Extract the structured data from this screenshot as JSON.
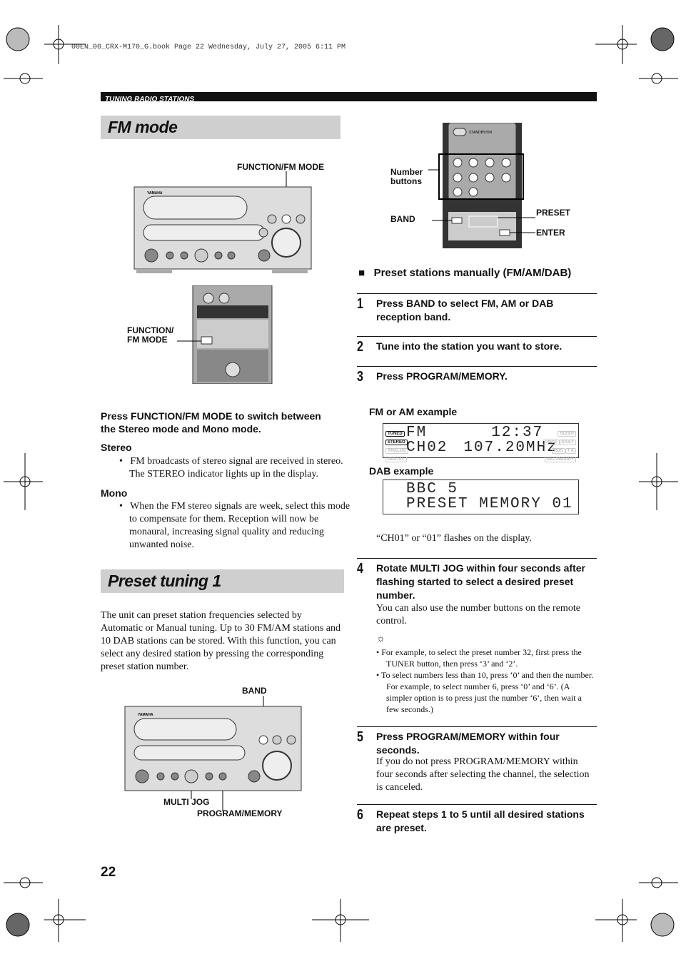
{
  "file_header": "00EN_00_CRX-M170_G.book  Page 22  Wednesday, July 27, 2005  6:11 PM",
  "section_bar": "TUNING RADIO STATIONS",
  "fm_mode": {
    "title": "FM mode",
    "label_function_top": "FUNCTION/FM MODE",
    "label_function_side": [
      "FUNCTION/",
      "FM MODE"
    ],
    "instruction": "Press FUNCTION/FM MODE to switch between the Stereo mode and Mono mode.",
    "stereo_heading": "Stereo",
    "stereo_text": "FM broadcasts of stereo signal are received in stereo. The STEREO indicator lights up in the display.",
    "mono_heading": "Mono",
    "mono_text": "When the FM stereo signals are week, select this mode to compensate for them. Reception will now be monaural, increasing signal quality and reducing unwanted noise."
  },
  "preset_tuning": {
    "title": "Preset tuning 1",
    "intro": "The unit can preset station frequencies selected by Automatic or Manual tuning. Up to 30 FM/AM stations and 10 DAB stations can be stored. With this function, you can select any desired station by pressing the corresponding preset station number.",
    "label_band": "BAND",
    "label_multijog": "MULTI JOG",
    "label_program": "PROGRAM/MEMORY"
  },
  "remote_labels": {
    "number": [
      "Number",
      "buttons"
    ],
    "band": "BAND",
    "preset": "PRESET",
    "enter": "ENTER",
    "standby": "STANDBY/ON"
  },
  "manual": {
    "heading": "Preset stations manually (FM/AM/DAB)",
    "steps": [
      {
        "n": "1",
        "text": "Press BAND to select FM, AM or DAB reception band."
      },
      {
        "n": "2",
        "text": "Tune into the station you want to store."
      },
      {
        "n": "3",
        "text": "Press PROGRAM/MEMORY."
      },
      {
        "n": "4",
        "text": "Rotate MULTI JOG within four seconds after flashing started to select a desired preset number."
      },
      {
        "n": "5",
        "text": "Press PROGRAM/MEMORY within four seconds."
      },
      {
        "n": "6",
        "text": "Repeat steps 1 to 5 until all desired stations are preset."
      }
    ],
    "fm_example_label": "FM or AM example",
    "fm_display": [
      "FM",
      "12:37",
      "CH02",
      "107.20MHz"
    ],
    "dab_example_label": "DAB example",
    "dab_display": [
      "BBC 5",
      "PRESET MEMORY",
      "01"
    ],
    "indicators": [
      "TUNED",
      "STEREO",
      "ANALOG",
      "DIGITAL",
      "SLEEP",
      "ONCE",
      "DAILY",
      "RDS",
      "T A",
      "SECONDARY"
    ],
    "flash_note": "“CH01” or “01” flashes on the display.",
    "step4_body": "You can also use the number buttons on the remote control.",
    "tips": [
      "For example, to select the preset number 32, first press the TUNER button, then press ‘3’ and ‘2’.",
      "To select numbers less than 10, press ‘0’ and then the number. For example, to select number 6, press ‘0’ and ‘6’. (A simpler option is to press just the number ‘6’, then wait a few seconds.)"
    ],
    "step5_body": "If you do not press PROGRAM/MEMORY within four seconds after selecting the channel, the selection is canceled."
  },
  "page_number": "22"
}
